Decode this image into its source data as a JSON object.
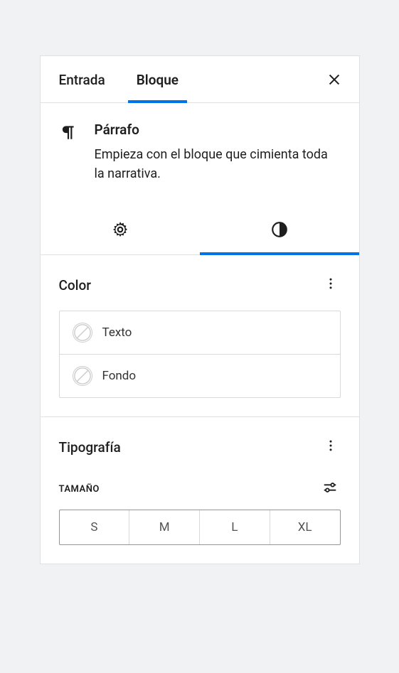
{
  "header": {
    "tabs": [
      {
        "label": "Entrada",
        "active": false
      },
      {
        "label": "Bloque",
        "active": true
      }
    ]
  },
  "block": {
    "title": "Párrafo",
    "description": "Empieza con el bloque que cimienta toda la narrativa."
  },
  "subtabs": {
    "settings": {
      "name": "settings-icon",
      "active": false
    },
    "styles": {
      "name": "styles-icon",
      "active": true
    }
  },
  "color_section": {
    "title": "Color",
    "items": [
      {
        "label": "Texto",
        "value": "none"
      },
      {
        "label": "Fondo",
        "value": "none"
      }
    ]
  },
  "typography_section": {
    "title": "Tipografía",
    "size_label": "TAMAÑO",
    "sizes": [
      "S",
      "M",
      "L",
      "XL"
    ]
  }
}
